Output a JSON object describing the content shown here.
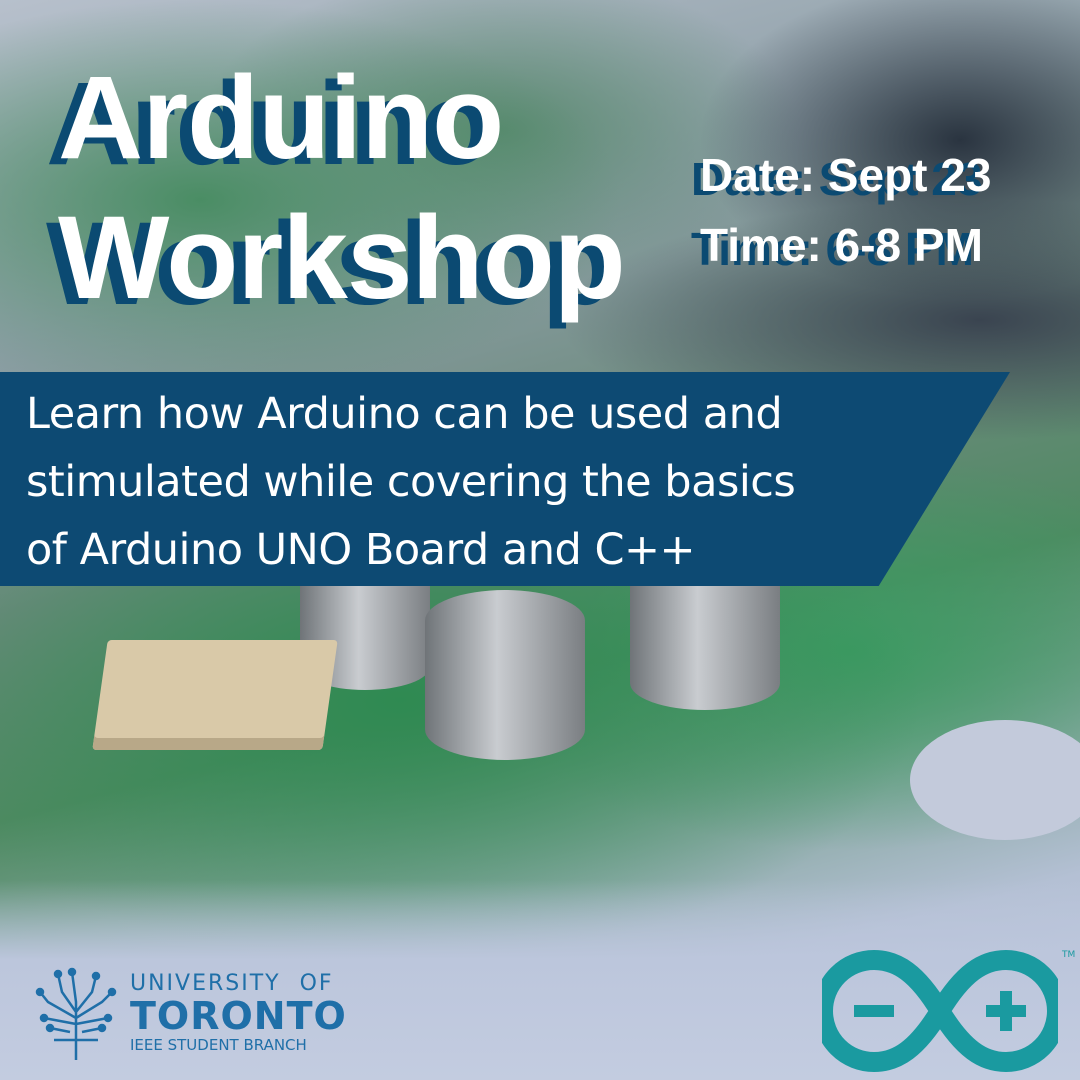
{
  "title": [
    "Arduino",
    "Workshop"
  ],
  "event": {
    "date": "Date: Sept 23",
    "time": "Time: 6-8 PM"
  },
  "description": [
    "Learn how Arduino can be used and",
    "stimulated while covering the basics",
    "of Arduino UNO Board and C++"
  ],
  "org_logo": {
    "line1": "UNIVERSITY OF",
    "line2": "TORONTO",
    "line3": "IEEE STUDENT BRANCH",
    "icon": "circuit-tree-icon"
  },
  "arduino_logo": {
    "icon": "arduino-infinity-logo",
    "trademark": "TM"
  },
  "colors": {
    "accent": "#0d4a73",
    "arduino": "#1a9aa0",
    "uoft": "#1f6fa8"
  }
}
